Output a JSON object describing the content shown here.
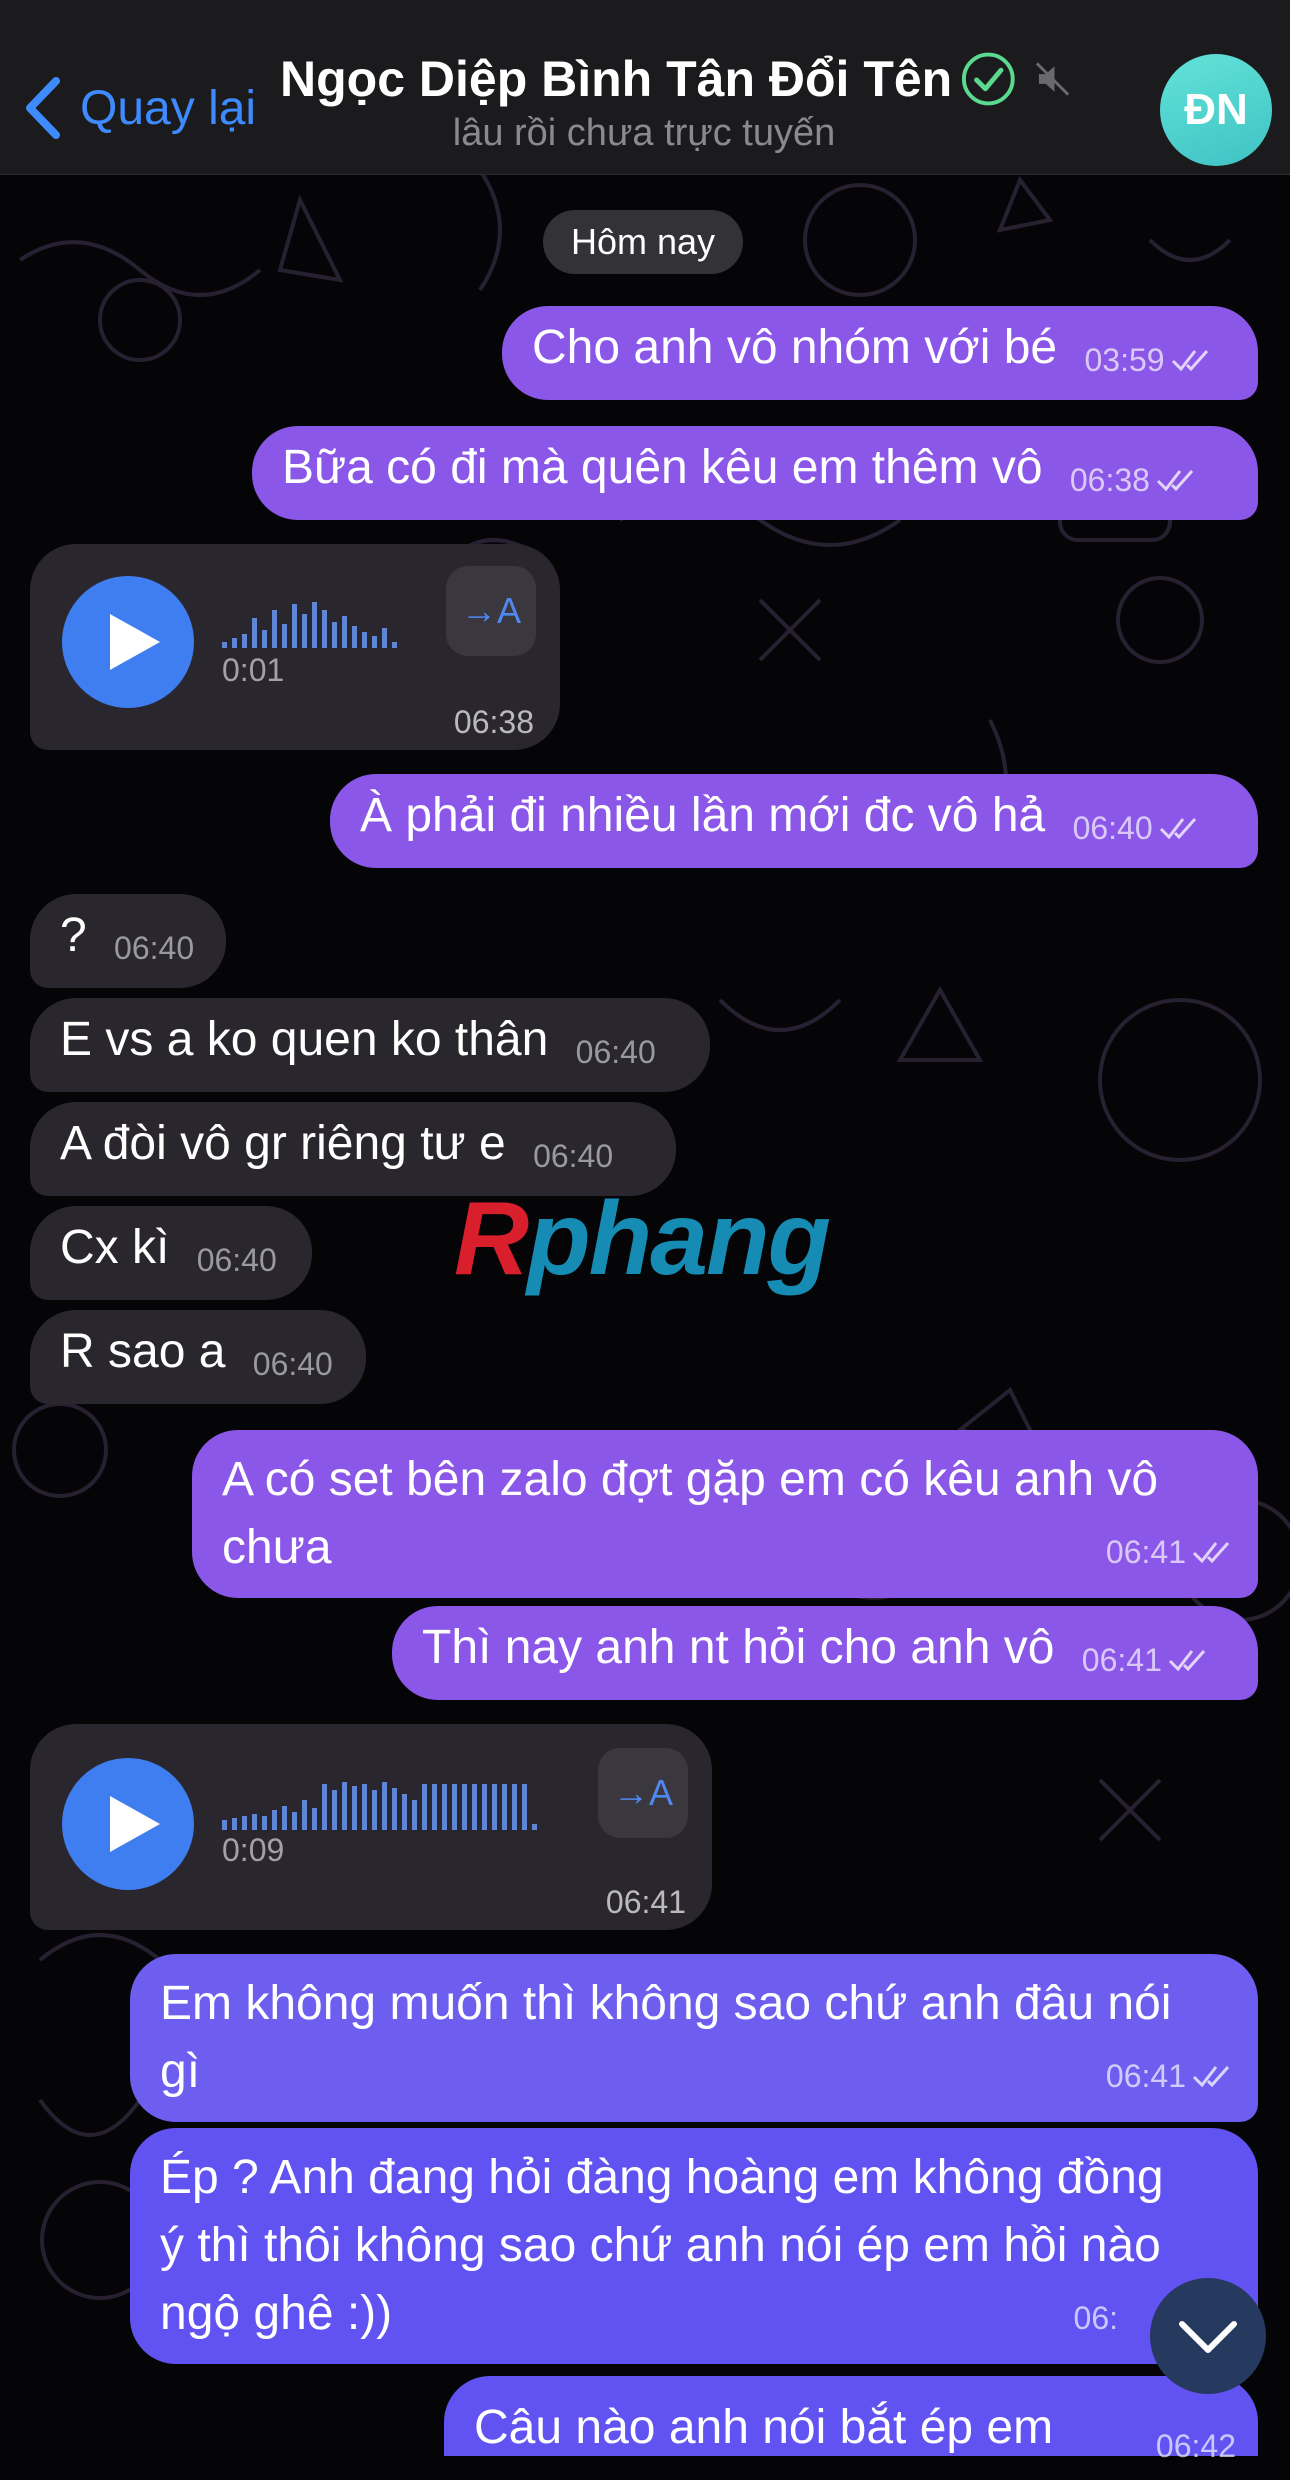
{
  "header": {
    "back_label": "Quay lại",
    "title": "Ngọc Diệp Bình Tân Đổi Tên",
    "status": "lâu rồi chưa trực tuyến",
    "avatar_initials": "ĐN",
    "icons": [
      "chevron-left-icon",
      "verified-check-icon",
      "muted-icon"
    ]
  },
  "date_separator": "Hôm nay",
  "messages": [
    {
      "dir": "out",
      "text": "Cho anh vô nhóm với bé",
      "time": "03:59"
    },
    {
      "dir": "out",
      "text": "Bữa có đi mà quên kêu em thêm vô",
      "time": "06:38"
    },
    {
      "dir": "in",
      "type": "voice",
      "duration": "0:01",
      "time": "06:38"
    },
    {
      "dir": "out",
      "text": "À phải đi nhiều lần mới đc vô hả",
      "time": "06:40"
    },
    {
      "dir": "in",
      "text": "?",
      "time": "06:40"
    },
    {
      "dir": "in",
      "text": "E vs a ko quen ko thân",
      "time": "06:40"
    },
    {
      "dir": "in",
      "text": "A đòi vô gr riêng tư e",
      "time": "06:40"
    },
    {
      "dir": "in",
      "text": "Cx kì",
      "time": "06:40"
    },
    {
      "dir": "in",
      "text": "R sao a",
      "time": "06:40"
    },
    {
      "dir": "out",
      "text_lines": [
        "A có set bên zalo đợt gặp em có kêu anh vô",
        "chưa"
      ],
      "time": "06:41"
    },
    {
      "dir": "out",
      "text": "Thì nay anh nt hỏi cho anh vô",
      "time": "06:41"
    },
    {
      "dir": "in",
      "type": "voice",
      "duration": "0:09",
      "time": "06:41"
    },
    {
      "dir": "out",
      "text_lines": [
        "Em không muốn thì không sao chứ anh đâu nói",
        "gì"
      ],
      "time": "06:41"
    },
    {
      "dir": "out",
      "text_lines": [
        "Ép ? Anh đang hỏi đàng hoàng em không đồng",
        "ý thì thôi không sao chứ anh nói ép em hồi nào",
        "ngộ ghê :))"
      ],
      "time": "06:"
    },
    {
      "dir": "out",
      "text": "Câu nào anh nói bắt ép em",
      "time": "06:42"
    }
  ],
  "transcribe_label": "→A",
  "watermark": {
    "part1": "R",
    "part2": "phang"
  },
  "colors": {
    "outgoing": "#8b57e8",
    "outgoing_late": "#6153f2",
    "incoming": "#2a262d",
    "accent": "#3e8bff",
    "play": "#3f7ef0"
  }
}
